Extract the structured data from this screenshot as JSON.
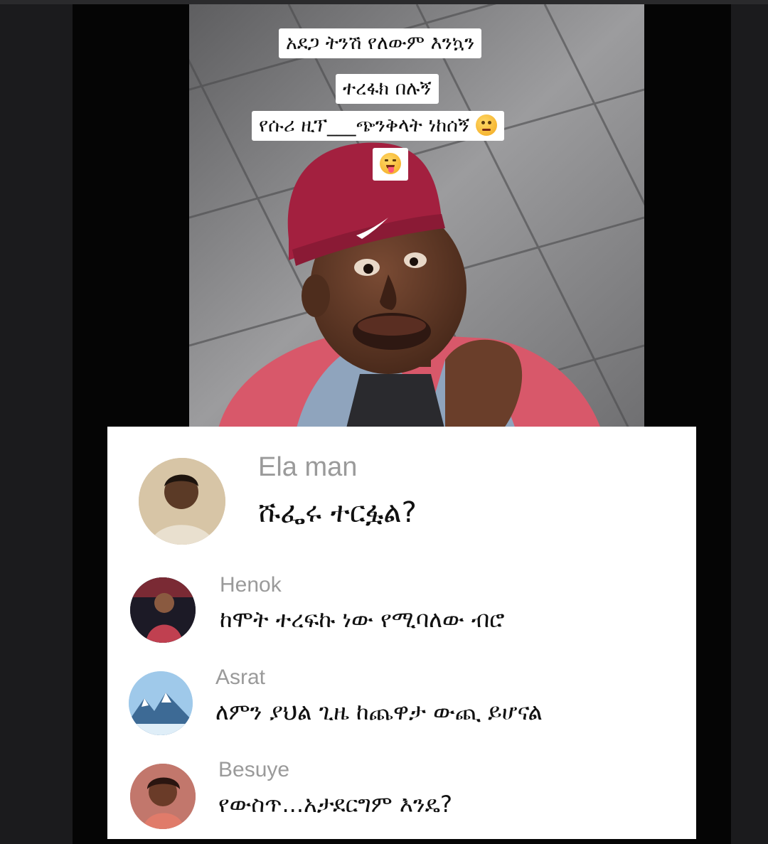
{
  "video": {
    "caption_lines": [
      "አደጋ ትንሽ የለውም እንኳን",
      "ተረፋክ በሉኝ",
      "የሱሪ ዚፕ___ጭንቅላት ነከሰኝ"
    ],
    "emojis": [
      "thinking-face-emoji",
      "squinting-face-with-tongue-emoji"
    ],
    "cap_logo": "swoosh-logo"
  },
  "comments": [
    {
      "username": "Ela man",
      "text": "ሹፌሩ ተርፏል?",
      "avatar": "man-avatar-icon"
    },
    {
      "username": "Henok",
      "text": "ከሞት ተረፍኩ ነው የሚባለው ብሮ",
      "avatar": "person-avatar-icon"
    },
    {
      "username": "Asrat",
      "text": "ለምን ያህል ጊዜ ከጨዋታ ውጪ ይሆናል",
      "avatar": "mountain-avatar-icon"
    },
    {
      "username": "Besuye",
      "text": "የውስጥ...አታደርግም እንዴ?",
      "avatar": "woman-avatar-icon"
    }
  ],
  "colors": {
    "background": "#050505",
    "panel": "#ffffff",
    "username": "#9a9a9a",
    "text": "#111111",
    "cap": "#a3203f"
  }
}
